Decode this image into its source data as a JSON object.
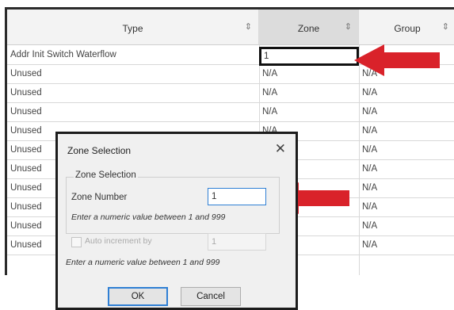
{
  "grid": {
    "columns": [
      {
        "label": "Type",
        "sort_icon": "sort-updown-icon"
      },
      {
        "label": "Zone",
        "sort_icon": "sort-updown-icon"
      },
      {
        "label": "Group",
        "sort_icon": "sort-updown-icon"
      }
    ],
    "rows": [
      {
        "type": "Addr Init Switch Waterflow",
        "zone": "1",
        "group": ""
      },
      {
        "type": "Unused",
        "zone": "N/A",
        "group": "N/A"
      },
      {
        "type": "Unused",
        "zone": "N/A",
        "group": "N/A"
      },
      {
        "type": "Unused",
        "zone": "N/A",
        "group": "N/A"
      },
      {
        "type": "Unused",
        "zone": "N/A",
        "group": "N/A"
      },
      {
        "type": "Unused",
        "zone": "N/A",
        "group": "N/A"
      },
      {
        "type": "Unused",
        "zone": "",
        "group": "N/A"
      },
      {
        "type": "Unused",
        "zone": "",
        "group": "N/A"
      },
      {
        "type": "Unused",
        "zone": "",
        "group": "N/A"
      },
      {
        "type": "Unused",
        "zone": "",
        "group": "N/A"
      },
      {
        "type": "Unused",
        "zone": "",
        "group": "N/A"
      }
    ]
  },
  "dialog": {
    "title": "Zone Selection",
    "close_icon": "close-icon",
    "group_legend": "Zone Selection",
    "zone_number_label": "Zone Number",
    "zone_number_value": "1",
    "zone_hint": "Enter a numeric value between 1 and 999",
    "auto_increment_label": "Auto increment by",
    "auto_increment_value": "1",
    "increment_hint": "Enter a numeric value between 1 and 999",
    "ok_label": "OK",
    "cancel_label": "Cancel"
  },
  "annotations": {
    "arrow_color": "#d9222a"
  }
}
